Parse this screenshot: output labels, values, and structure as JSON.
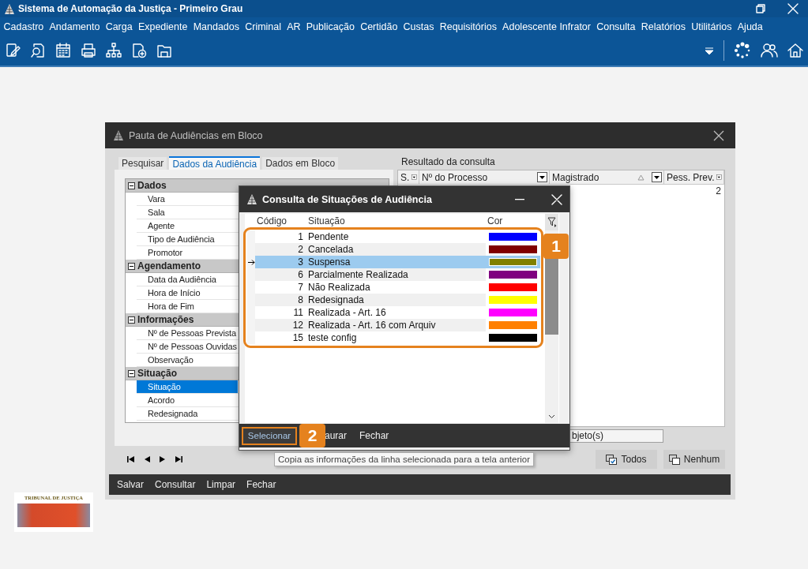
{
  "app": {
    "title": "Sistema de Automação da Justiça - Primeiro Grau",
    "menu": [
      "Cadastro",
      "Andamento",
      "Carga",
      "Expediente",
      "Mandados",
      "Criminal",
      "AR",
      "Publicação",
      "Certidão",
      "Custas",
      "Requisitórios",
      "Adolescente Infrator",
      "Consulta",
      "Relatórios",
      "Utilitários",
      "Ajuda"
    ]
  },
  "pauta_window": {
    "title": "Pauta de Audiências em Bloco",
    "tabs": [
      {
        "label": "Pesquisar",
        "selected": false
      },
      {
        "label": "Dados da Audiência",
        "selected": true
      },
      {
        "label": "Dados em Bloco",
        "selected": false
      }
    ],
    "property_groups": [
      {
        "label": "Dados",
        "expanded": true,
        "items": [
          {
            "label": "Vara",
            "selected": false
          },
          {
            "label": "Sala",
            "selected": false
          },
          {
            "label": "Agente",
            "selected": false
          },
          {
            "label": "Tipo de Audiência",
            "selected": false
          },
          {
            "label": "Promotor",
            "selected": false
          }
        ]
      },
      {
        "label": "Agendamento",
        "expanded": true,
        "items": [
          {
            "label": "Data da Audiência",
            "selected": false
          },
          {
            "label": "Hora de Início",
            "selected": false
          },
          {
            "label": "Hora de Fim",
            "selected": false
          }
        ]
      },
      {
        "label": "Informações",
        "expanded": true,
        "items": [
          {
            "label": "Nº de Pessoas Prevista",
            "selected": false
          },
          {
            "label": "Nº de Pessoas Ouvidas",
            "selected": false
          },
          {
            "label": "Observação",
            "selected": false
          }
        ]
      },
      {
        "label": "Situação",
        "expanded": true,
        "items": [
          {
            "label": "Situação",
            "selected": true
          },
          {
            "label": "Acordo",
            "selected": false
          },
          {
            "label": "Redesignada",
            "selected": false
          }
        ]
      }
    ],
    "results": {
      "label": "Resultado da consulta",
      "columns": [
        {
          "label": "S.",
          "sorted": false
        },
        {
          "label": "Nº do Processo",
          "sorted": false
        },
        {
          "label": "Magistrado",
          "sorted": true
        },
        {
          "label": "Pess. Prev.",
          "sorted": false
        }
      ],
      "rows": [
        {
          "pess_prev": "2"
        }
      ]
    },
    "count_field": {
      "value": "bjeto(s)"
    },
    "select_buttons": [
      "Todos",
      "Nenhum"
    ],
    "bottom_bar": [
      "Salvar",
      "Consultar",
      "Limpar",
      "Fechar"
    ]
  },
  "dialog": {
    "title": "Consulta de Situações de Audiência",
    "columns": [
      "Código",
      "Situação",
      "Cor"
    ],
    "rows": [
      {
        "code": "1",
        "name": "Pendente",
        "color": "#0000ff",
        "selected": false
      },
      {
        "code": "2",
        "name": "Cancelada",
        "color": "#800000",
        "selected": false
      },
      {
        "code": "3",
        "name": "Suspensa",
        "color": "#808000",
        "selected": true
      },
      {
        "code": "6",
        "name": "Parcialmente Realizada",
        "color": "#800080",
        "selected": false
      },
      {
        "code": "7",
        "name": "Não Realizada",
        "color": "#ff0000",
        "selected": false
      },
      {
        "code": "8",
        "name": "Redesignada",
        "color": "#ffff00",
        "selected": false
      },
      {
        "code": "11",
        "name": "Realizada - Art. 16",
        "color": "#ff00ff",
        "selected": false
      },
      {
        "code": "12",
        "name": "Realizada - Art. 16 com Arquiv",
        "color": "#ff8000",
        "selected": false
      },
      {
        "code": "15",
        "name": "teste config",
        "color": "#000000",
        "selected": false
      }
    ],
    "buttons": [
      {
        "label": "Selecionar",
        "highlighted": true
      },
      {
        "label": "aurar",
        "highlighted": false
      },
      {
        "label": "Fechar",
        "highlighted": false
      }
    ]
  },
  "tooltip": "Copia as informações da linha selecionada para a tela anterior",
  "annotations": [
    {
      "number": "1"
    },
    {
      "number": "2"
    }
  ],
  "logo": {
    "text": "TRIBUNAL DE JUSTIÇA"
  }
}
